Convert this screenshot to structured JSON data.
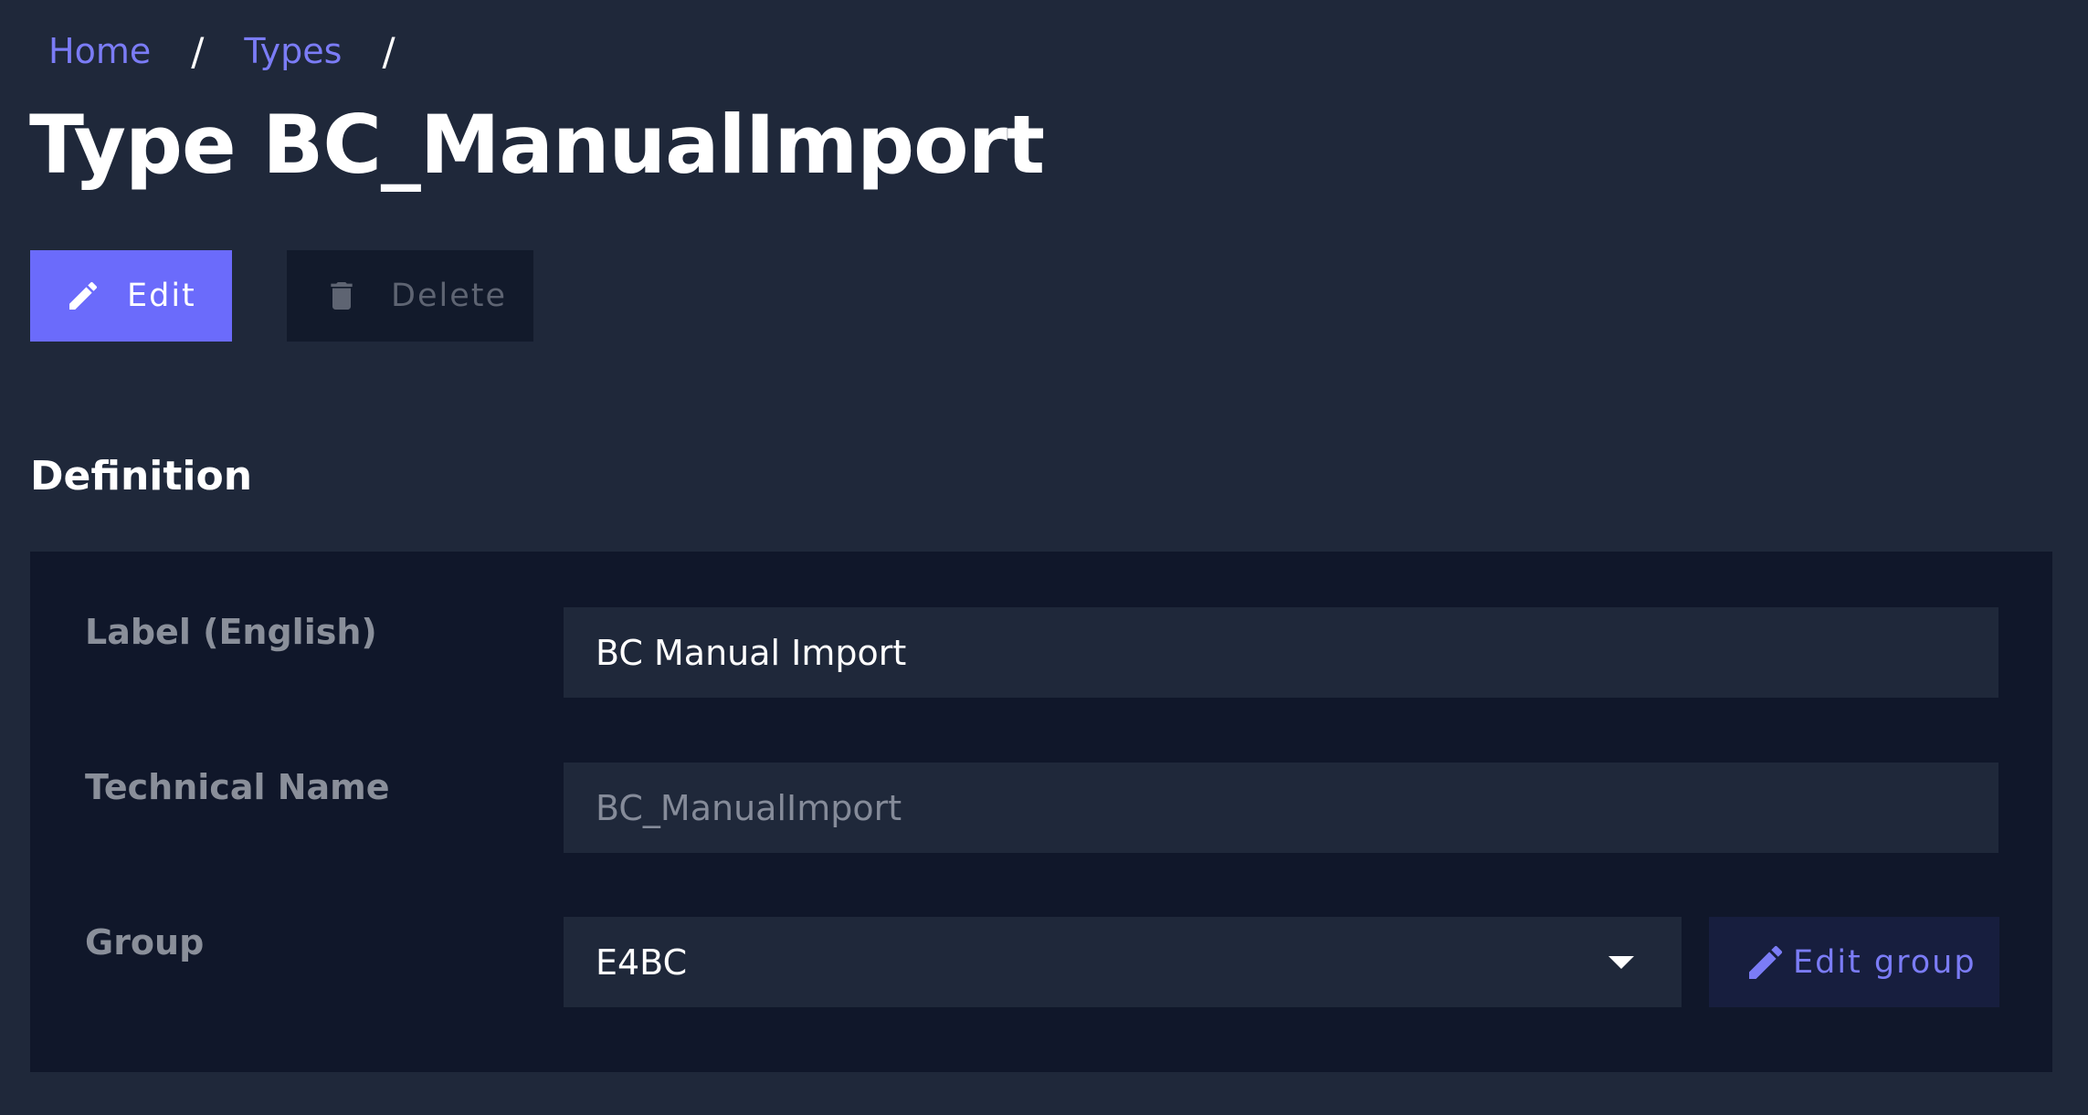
{
  "breadcrumb": {
    "items": [
      {
        "label": "Home"
      },
      {
        "label": "Types"
      }
    ],
    "separator": "/"
  },
  "page": {
    "title": "Type BC_ManualImport"
  },
  "actions": {
    "edit_label": "Edit",
    "delete_label": "Delete",
    "edit_icon": "pencil-icon",
    "delete_icon": "trash-icon"
  },
  "definition": {
    "section_title": "Definition",
    "fields": {
      "label_english": {
        "label": "Label (English)",
        "value": "BC Manual Import"
      },
      "technical_name": {
        "label": "Technical Name",
        "value": "BC_ManualImport"
      },
      "group": {
        "label": "Group",
        "value": "E4BC",
        "edit_group_label": "Edit group"
      }
    }
  },
  "colors": {
    "background": "#1f283a",
    "panel": "#10172a",
    "accent": "#6b6bfb",
    "link": "#7b7cf6",
    "muted_text": "#8a8f9a"
  }
}
